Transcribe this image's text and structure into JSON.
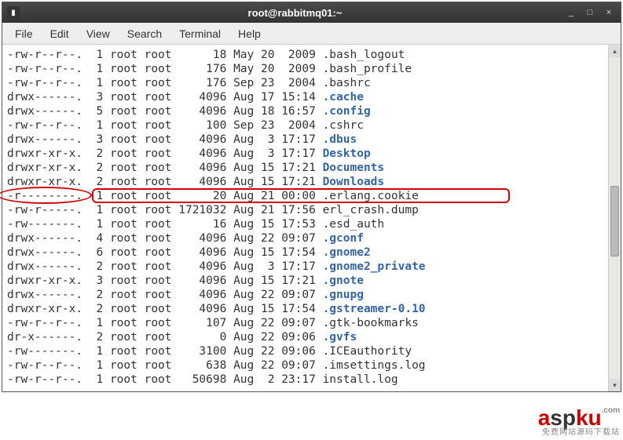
{
  "window": {
    "title": "root@rabbitmq01:~",
    "min_label": "_",
    "max_label": "□",
    "close_label": "×"
  },
  "menubar": {
    "items": [
      "File",
      "Edit",
      "View",
      "Search",
      "Terminal",
      "Help"
    ]
  },
  "listing": [
    {
      "perm": "-rw-r--r--.",
      "links": "1",
      "user": "root",
      "group": "root",
      "size": "18",
      "month": "May",
      "day": "20",
      "time": "2009",
      "name": ".bash_logout",
      "dir": false
    },
    {
      "perm": "-rw-r--r--.",
      "links": "1",
      "user": "root",
      "group": "root",
      "size": "176",
      "month": "May",
      "day": "20",
      "time": "2009",
      "name": ".bash_profile",
      "dir": false
    },
    {
      "perm": "-rw-r--r--.",
      "links": "1",
      "user": "root",
      "group": "root",
      "size": "176",
      "month": "Sep",
      "day": "23",
      "time": "2004",
      "name": ".bashrc",
      "dir": false
    },
    {
      "perm": "drwx------.",
      "links": "3",
      "user": "root",
      "group": "root",
      "size": "4096",
      "month": "Aug",
      "day": "17",
      "time": "15:14",
      "name": ".cache",
      "dir": true
    },
    {
      "perm": "drwx------.",
      "links": "5",
      "user": "root",
      "group": "root",
      "size": "4096",
      "month": "Aug",
      "day": "18",
      "time": "16:57",
      "name": ".config",
      "dir": true
    },
    {
      "perm": "-rw-r--r--.",
      "links": "1",
      "user": "root",
      "group": "root",
      "size": "100",
      "month": "Sep",
      "day": "23",
      "time": "2004",
      "name": ".cshrc",
      "dir": false
    },
    {
      "perm": "drwx------.",
      "links": "3",
      "user": "root",
      "group": "root",
      "size": "4096",
      "month": "Aug",
      "day": "3",
      "time": "17:17",
      "name": ".dbus",
      "dir": true
    },
    {
      "perm": "drwxr-xr-x.",
      "links": "2",
      "user": "root",
      "group": "root",
      "size": "4096",
      "month": "Aug",
      "day": "3",
      "time": "17:17",
      "name": "Desktop",
      "dir": true
    },
    {
      "perm": "drwxr-xr-x.",
      "links": "2",
      "user": "root",
      "group": "root",
      "size": "4096",
      "month": "Aug",
      "day": "15",
      "time": "17:21",
      "name": "Documents",
      "dir": true
    },
    {
      "perm": "drwxr-xr-x.",
      "links": "2",
      "user": "root",
      "group": "root",
      "size": "4096",
      "month": "Aug",
      "day": "15",
      "time": "17:21",
      "name": "Downloads",
      "dir": true
    },
    {
      "perm": "-r--------.",
      "links": "1",
      "user": "root",
      "group": "root",
      "size": "20",
      "month": "Aug",
      "day": "21",
      "time": "00:00",
      "name": ".erlang.cookie",
      "dir": false,
      "highlight": true
    },
    {
      "perm": "-rw-r-----.",
      "links": "1",
      "user": "root",
      "group": "root",
      "size": "1721032",
      "month": "Aug",
      "day": "21",
      "time": "17:56",
      "name": "erl_crash.dump",
      "dir": false
    },
    {
      "perm": "-rw-------.",
      "links": "1",
      "user": "root",
      "group": "root",
      "size": "16",
      "month": "Aug",
      "day": "15",
      "time": "17:53",
      "name": ".esd_auth",
      "dir": false
    },
    {
      "perm": "drwx------.",
      "links": "4",
      "user": "root",
      "group": "root",
      "size": "4096",
      "month": "Aug",
      "day": "22",
      "time": "09:07",
      "name": ".gconf",
      "dir": true
    },
    {
      "perm": "drwx------.",
      "links": "6",
      "user": "root",
      "group": "root",
      "size": "4096",
      "month": "Aug",
      "day": "15",
      "time": "17:54",
      "name": ".gnome2",
      "dir": true
    },
    {
      "perm": "drwx------.",
      "links": "2",
      "user": "root",
      "group": "root",
      "size": "4096",
      "month": "Aug",
      "day": "3",
      "time": "17:17",
      "name": ".gnome2_private",
      "dir": true
    },
    {
      "perm": "drwxr-xr-x.",
      "links": "3",
      "user": "root",
      "group": "root",
      "size": "4096",
      "month": "Aug",
      "day": "15",
      "time": "17:21",
      "name": ".gnote",
      "dir": true
    },
    {
      "perm": "drwx------.",
      "links": "2",
      "user": "root",
      "group": "root",
      "size": "4096",
      "month": "Aug",
      "day": "22",
      "time": "09:07",
      "name": ".gnupg",
      "dir": true
    },
    {
      "perm": "drwxr-xr-x.",
      "links": "2",
      "user": "root",
      "group": "root",
      "size": "4096",
      "month": "Aug",
      "day": "15",
      "time": "17:54",
      "name": ".gstreamer-0.10",
      "dir": true
    },
    {
      "perm": "-rw-r--r--.",
      "links": "1",
      "user": "root",
      "group": "root",
      "size": "107",
      "month": "Aug",
      "day": "22",
      "time": "09:07",
      "name": ".gtk-bookmarks",
      "dir": false
    },
    {
      "perm": "dr-x------.",
      "links": "2",
      "user": "root",
      "group": "root",
      "size": "0",
      "month": "Aug",
      "day": "22",
      "time": "09:06",
      "name": ".gvfs",
      "dir": true
    },
    {
      "perm": "-rw-------.",
      "links": "1",
      "user": "root",
      "group": "root",
      "size": "3100",
      "month": "Aug",
      "day": "22",
      "time": "09:06",
      "name": ".ICEauthority",
      "dir": false
    },
    {
      "perm": "-rw-r--r--.",
      "links": "1",
      "user": "root",
      "group": "root",
      "size": "638",
      "month": "Aug",
      "day": "22",
      "time": "09:07",
      "name": ".imsettings.log",
      "dir": false
    },
    {
      "perm": "-rw-r--r--.",
      "links": "1",
      "user": "root",
      "group": "root",
      "size": "50698",
      "month": "Aug",
      "day": "2",
      "time": "23:17",
      "name": "install.log",
      "dir": false
    }
  ],
  "watermark": {
    "part1": "a",
    "part2": "sp",
    "part3": "ku",
    "suffix": ".com",
    "subtitle": "免费网站源码下载站"
  }
}
